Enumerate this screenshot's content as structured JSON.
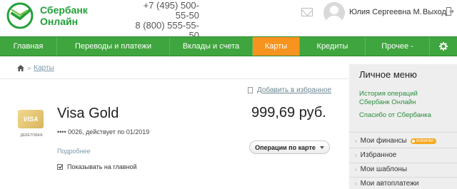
{
  "header": {
    "logo_line1": "Сбербанк",
    "logo_line2": "Онлайн",
    "phone1": "+7 (495) 500-55-50",
    "phone2": "8 (800) 555-55-50",
    "user_name": "Юлия Сергеевна М.",
    "logout_label": "Выход"
  },
  "nav": {
    "items": [
      {
        "label": "Главная"
      },
      {
        "label": "Переводы и платежи"
      },
      {
        "label": "Вклады и счета"
      },
      {
        "label": "Карты"
      },
      {
        "label": "Кредиты"
      },
      {
        "label": "Прочее -"
      }
    ],
    "active_index": 3,
    "gear_icon": "gear-icon"
  },
  "breadcrumb": {
    "current": "Карты"
  },
  "actions": {
    "add_favorites": "Добавить в избранное",
    "card_operations": "Операции по карте"
  },
  "card": {
    "brand": "VISA",
    "type_label": "ДЕБЕТОВАЯ",
    "title": "Visa Gold",
    "balance": "999,69 руб.",
    "number_info": "•••• 0026, действует по 01/2019",
    "details_link": "Подробнее",
    "show_on_main": "Показывать на главной",
    "show_on_main_checked": true
  },
  "sidebar": {
    "title": "Личное меню",
    "links": [
      "История операций",
      "Сбербанк Онлайн",
      "Спасибо от Сбербанка"
    ],
    "items": [
      {
        "label": "Мои финансы",
        "badge": "НОВИНКА"
      },
      {
        "label": "Избранное"
      },
      {
        "label": "Мои шаблоны"
      },
      {
        "label": "Мои автоплатежи"
      }
    ]
  },
  "colors": {
    "brand_green": "#3fa53e",
    "active_orange": "#f7931e",
    "link_green": "#2b8d3d"
  }
}
